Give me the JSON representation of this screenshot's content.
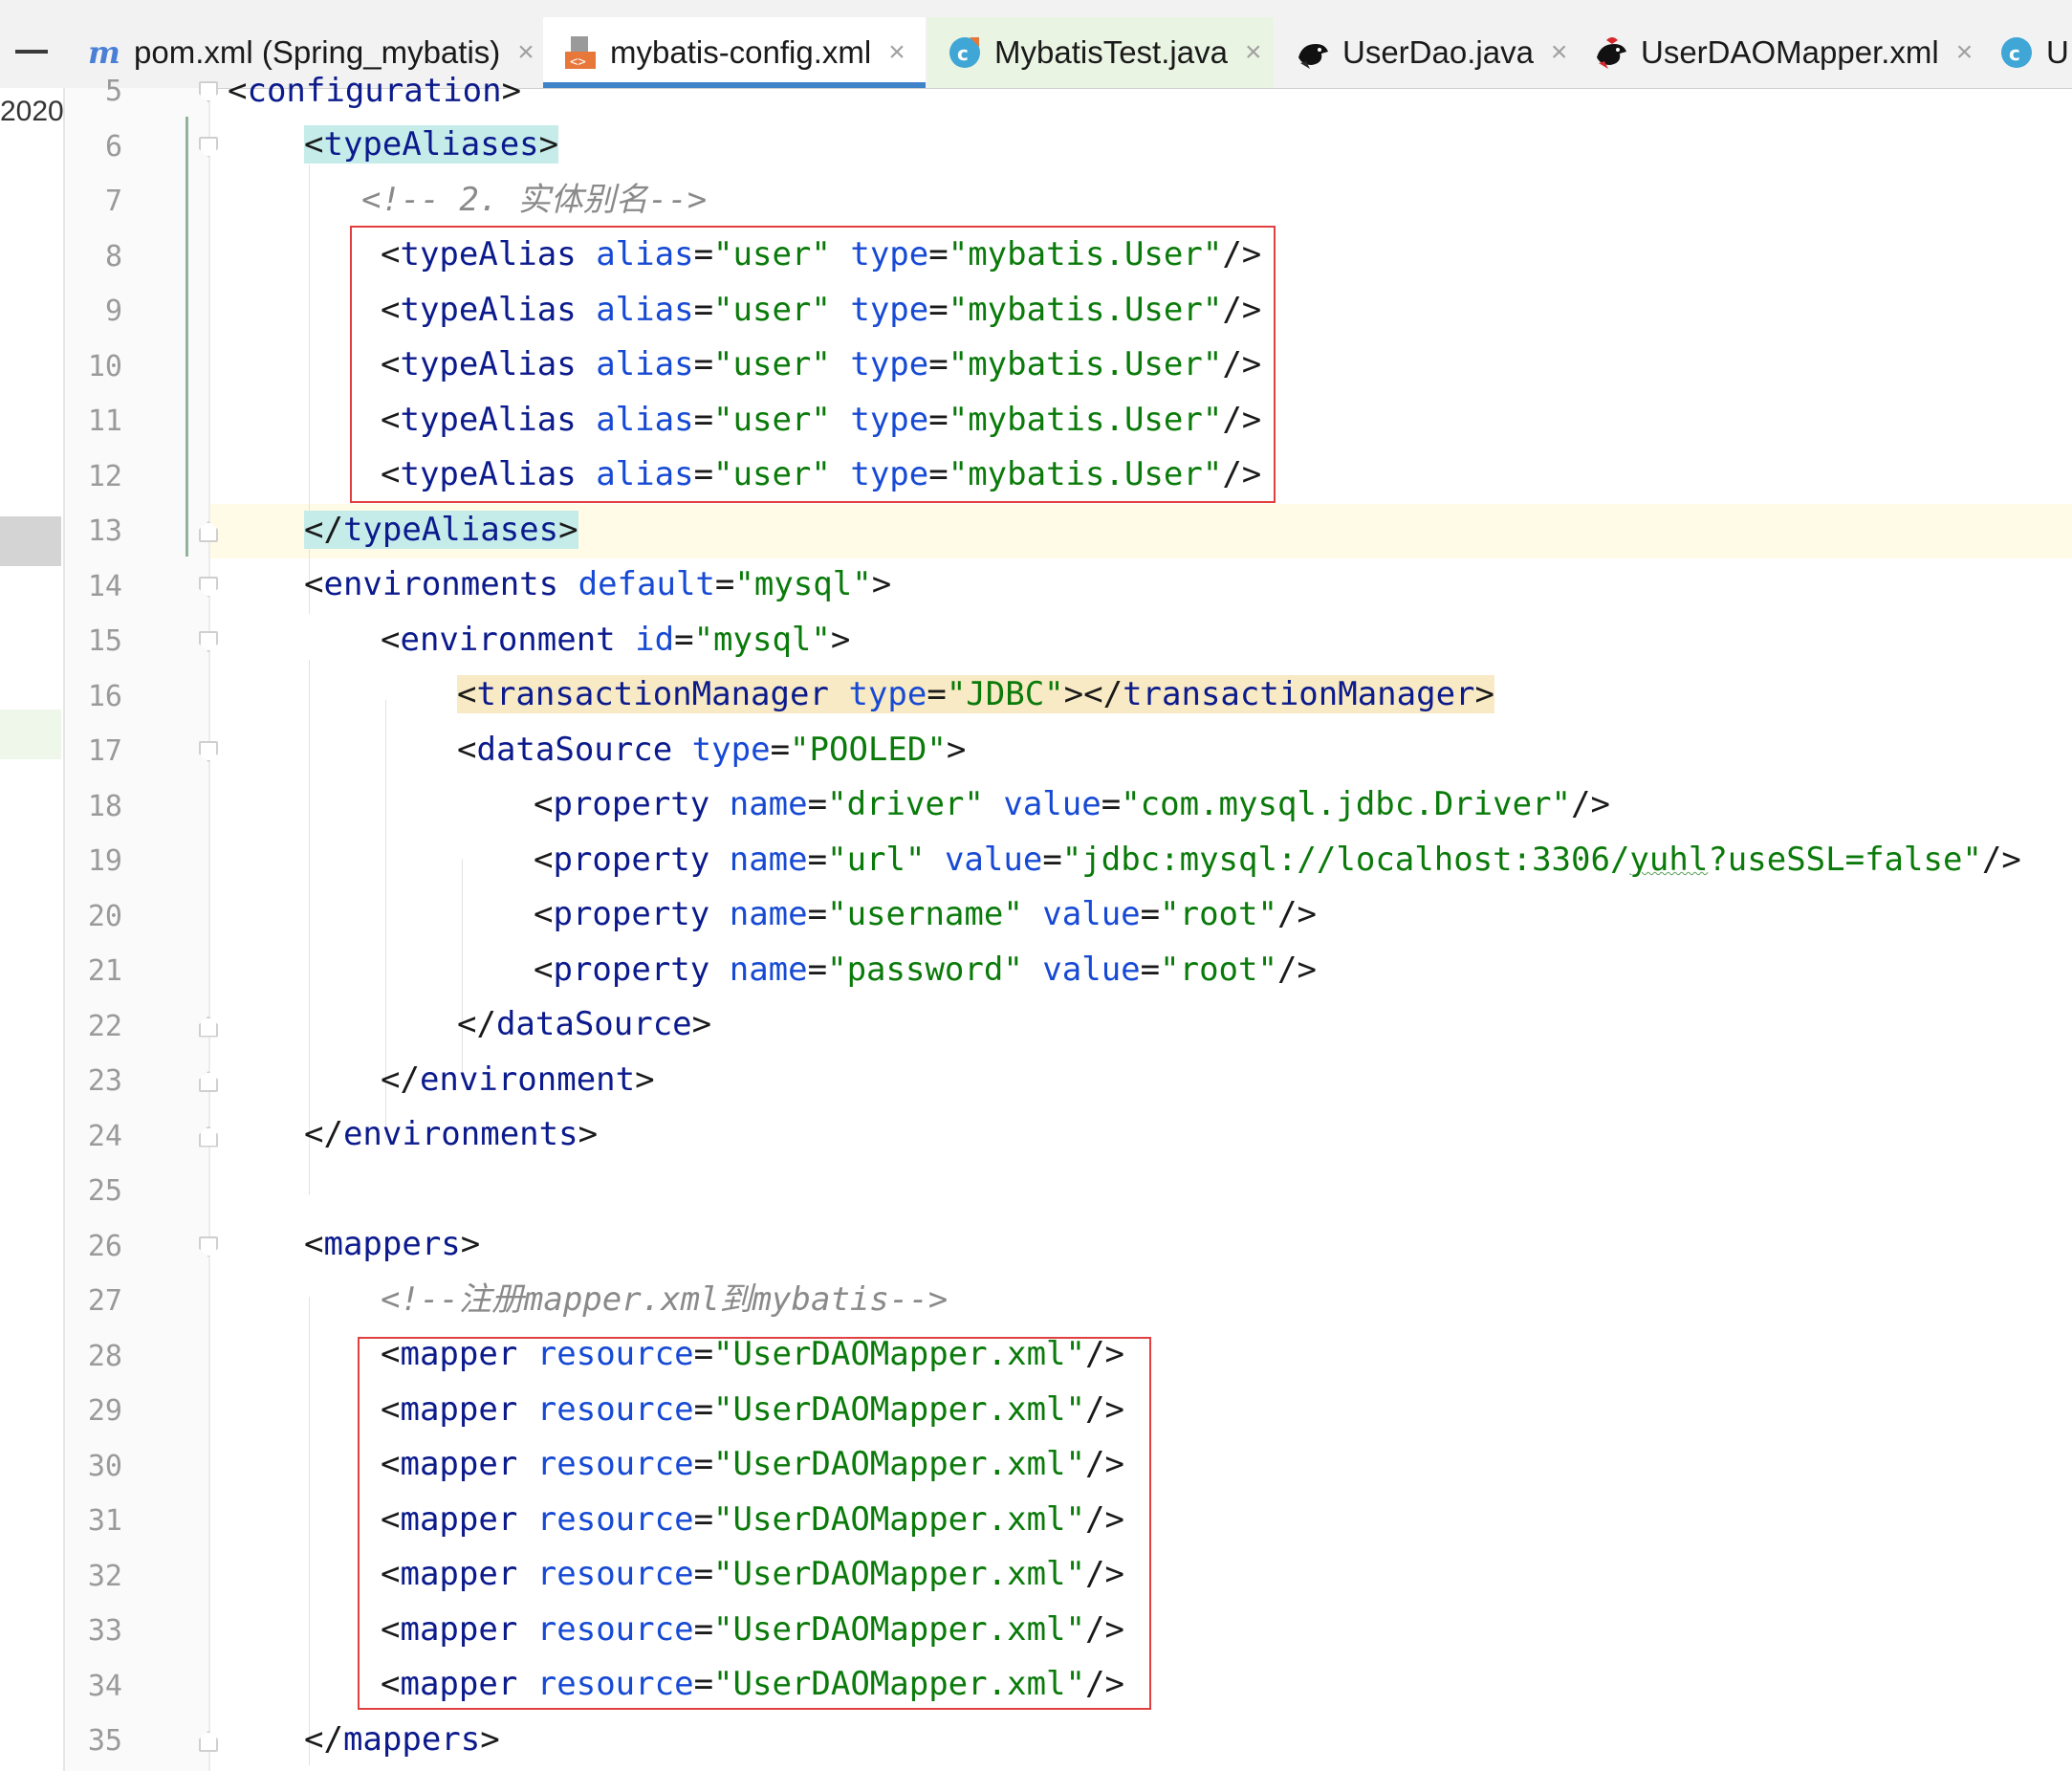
{
  "tabs": [
    {
      "label": "pom.xml (Spring_mybatis)",
      "icon": "maven-icon",
      "closable": true,
      "active": false
    },
    {
      "label": "mybatis-config.xml",
      "icon": "xml-file-icon",
      "closable": true,
      "active": true
    },
    {
      "label": "MybatisTest.java",
      "icon": "java-class-icon",
      "closable": true,
      "active": false
    },
    {
      "label": "UserDao.java",
      "icon": "mybatis-bird-icon",
      "closable": true,
      "active": false
    },
    {
      "label": "UserDAOMapper.xml",
      "icon": "mybatis-bird-red-icon",
      "closable": true,
      "active": false
    },
    {
      "label": "U",
      "icon": "class-icon",
      "closable": false,
      "active": false
    }
  ],
  "tab_close_glyph": "×",
  "left_strip_text": "2020",
  "editor": {
    "line_numbers": [
      "5",
      "6",
      "7",
      "8",
      "9",
      "10",
      "11",
      "12",
      "13",
      "14",
      "15",
      "16",
      "17",
      "18",
      "19",
      "20",
      "21",
      "22",
      "23",
      "24",
      "25",
      "26",
      "27",
      "28",
      "29",
      "30",
      "31",
      "32",
      "33",
      "34",
      "35"
    ],
    "lines": {
      "l5": {
        "open": "<",
        "tag": "configuration",
        "close": ">"
      },
      "l6": {
        "open": "<",
        "tag": "typeAliases",
        "close": ">"
      },
      "l7": {
        "comment": "<!-- 2. 实体别名-->"
      },
      "l8": {
        "open": "<",
        "tag": "typeAlias",
        "attr1": "alias",
        "eq1": "=",
        "val1": "\"user\"",
        "attr2": "type",
        "eq2": "=",
        "val2": "\"mybatis.User\"",
        "close": "/>"
      },
      "l9": {
        "open": "<",
        "tag": "typeAlias",
        "attr1": "alias",
        "eq1": "=",
        "val1": "\"user\"",
        "attr2": "type",
        "eq2": "=",
        "val2": "\"mybatis.User\"",
        "close": "/>"
      },
      "l10": {
        "open": "<",
        "tag": "typeAlias",
        "attr1": "alias",
        "eq1": "=",
        "val1": "\"user\"",
        "attr2": "type",
        "eq2": "=",
        "val2": "\"mybatis.User\"",
        "close": "/>"
      },
      "l11": {
        "open": "<",
        "tag": "typeAlias",
        "attr1": "alias",
        "eq1": "=",
        "val1": "\"user\"",
        "attr2": "type",
        "eq2": "=",
        "val2": "\"mybatis.User\"",
        "close": "/>"
      },
      "l12": {
        "open": "<",
        "tag": "typeAlias",
        "attr1": "alias",
        "eq1": "=",
        "val1": "\"user\"",
        "attr2": "type",
        "eq2": "=",
        "val2": "\"mybatis.User\"",
        "close": "/>"
      },
      "l13": {
        "open": "</",
        "tag": "typeAliases",
        "close": ">"
      },
      "l14": {
        "open": "<",
        "tag": "environments",
        "attr1": "default",
        "eq1": "=",
        "val1": "\"mysql\"",
        "close": ">"
      },
      "l15": {
        "open": "<",
        "tag": "environment",
        "attr1": "id",
        "eq1": "=",
        "val1": "\"mysql\"",
        "close": ">"
      },
      "l16": {
        "open": "<",
        "tag": "transactionManager",
        "attr1": "type",
        "eq1": "=",
        "val1": "\"JDBC\"",
        "mid": "></",
        "tag2": "transactionManager",
        "close": ">"
      },
      "l17": {
        "open": "<",
        "tag": "dataSource",
        "attr1": "type",
        "eq1": "=",
        "val1": "\"POOLED\"",
        "close": ">"
      },
      "l18": {
        "open": "<",
        "tag": "property",
        "attr1": "name",
        "eq1": "=",
        "val1": "\"driver\"",
        "attr2": "value",
        "eq2": "=",
        "val2": "\"com.mysql.jdbc.Driver\"",
        "close": "/>"
      },
      "l19": {
        "open": "<",
        "tag": "property",
        "attr1": "name",
        "eq1": "=",
        "val1": "\"url\"",
        "attr2": "value",
        "eq2": "=",
        "val2a": "\"jdbc:mysql://localhost:3306/",
        "val2b": "yuhl",
        "val2c": "?useSSL=false\"",
        "close": "/>"
      },
      "l20": {
        "open": "<",
        "tag": "property",
        "attr1": "name",
        "eq1": "=",
        "val1": "\"username\"",
        "attr2": "value",
        "eq2": "=",
        "val2": "\"root\"",
        "close": "/>"
      },
      "l21": {
        "open": "<",
        "tag": "property",
        "attr1": "name",
        "eq1": "=",
        "val1": "\"password\"",
        "attr2": "value",
        "eq2": "=",
        "val2": "\"root\"",
        "close": "/>"
      },
      "l22": {
        "open": "</",
        "tag": "dataSource",
        "close": ">"
      },
      "l23": {
        "open": "</",
        "tag": "environment",
        "close": ">"
      },
      "l24": {
        "open": "</",
        "tag": "environments",
        "close": ">"
      },
      "l26": {
        "open": "<",
        "tag": "mappers",
        "close": ">"
      },
      "l27": {
        "comment": "<!--注册mapper.xml到mybatis-->"
      },
      "l28": {
        "open": "<",
        "tag": "mapper",
        "attr1": "resource",
        "eq1": "=",
        "val1": "\"UserDAOMapper.xml\"",
        "close": "/>"
      },
      "l29": {
        "open": "<",
        "tag": "mapper",
        "attr1": "resource",
        "eq1": "=",
        "val1": "\"UserDAOMapper.xml\"",
        "close": "/>"
      },
      "l30": {
        "open": "<",
        "tag": "mapper",
        "attr1": "resource",
        "eq1": "=",
        "val1": "\"UserDAOMapper.xml\"",
        "close": "/>"
      },
      "l31": {
        "open": "<",
        "tag": "mapper",
        "attr1": "resource",
        "eq1": "=",
        "val1": "\"UserDAOMapper.xml\"",
        "close": "/>"
      },
      "l32": {
        "open": "<",
        "tag": "mapper",
        "attr1": "resource",
        "eq1": "=",
        "val1": "\"UserDAOMapper.xml\"",
        "close": "/>"
      },
      "l33": {
        "open": "<",
        "tag": "mapper",
        "attr1": "resource",
        "eq1": "=",
        "val1": "\"UserDAOMapper.xml\"",
        "close": "/>"
      },
      "l34": {
        "open": "<",
        "tag": "mapper",
        "attr1": "resource",
        "eq1": "=",
        "val1": "\"UserDAOMapper.xml\"",
        "close": "/>"
      },
      "l35": {
        "open": "</",
        "tag": "mappers",
        "close": ">"
      }
    }
  },
  "colors": {
    "tag": "#0b1a8c",
    "attribute": "#174ad4",
    "string": "#0a7a0a",
    "comment": "#8a8a8a",
    "highlight_box": "#e04040",
    "tag_match": "#c6ecea",
    "caret_line": "#fffbe6",
    "active_tab_underline": "#4083c9"
  }
}
